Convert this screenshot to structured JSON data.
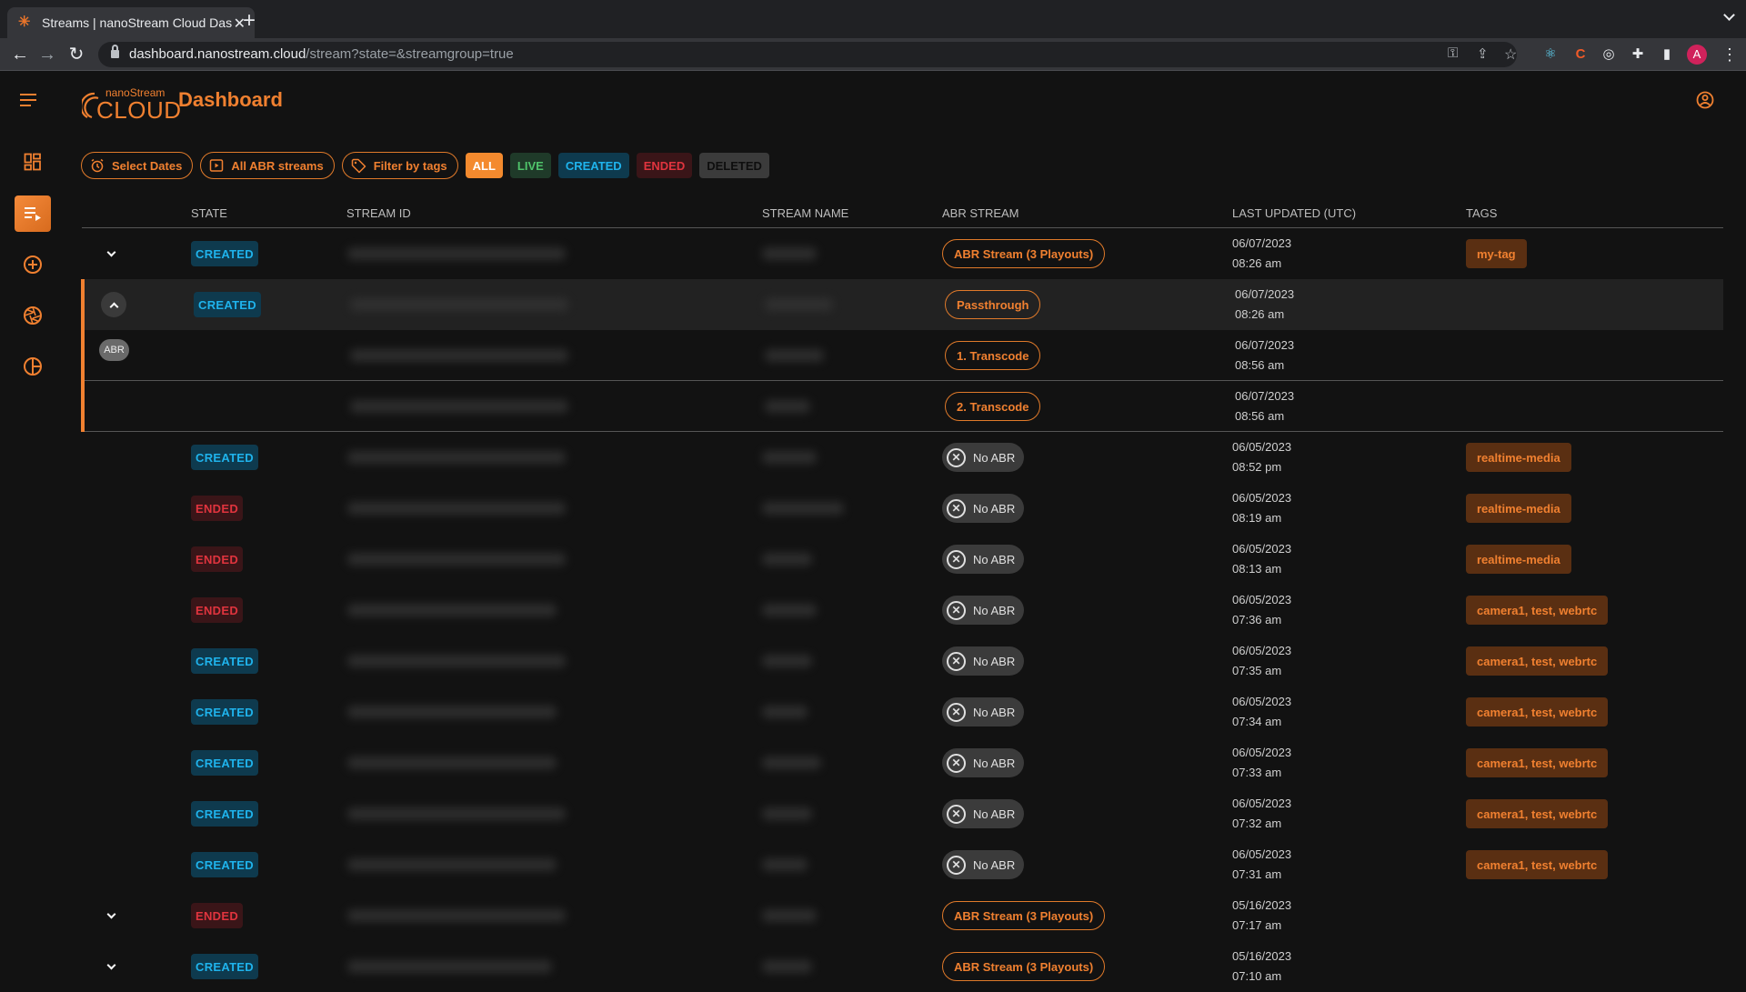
{
  "browser": {
    "tab_title": "Streams | nanoStream Cloud Dashboard",
    "url_host": "dashboard.nanostream.cloud",
    "url_path": "/stream?state=&streamgroup=true",
    "profile_initial": "A"
  },
  "app": {
    "logo_small": "nanoStream",
    "logo_big": "CLOUD",
    "title": "Dashboard"
  },
  "sidebar": {
    "items": [
      {
        "name": "dashboard",
        "icon": "dashboard-icon",
        "active": false
      },
      {
        "name": "streams",
        "icon": "stream-list-icon",
        "active": true
      },
      {
        "name": "create-stream",
        "icon": "add-circle-icon",
        "active": false
      },
      {
        "name": "apertures",
        "icon": "shutter-icon",
        "active": false
      },
      {
        "name": "analytics",
        "icon": "pie-chart-icon",
        "active": false
      }
    ]
  },
  "filters": {
    "select_dates": "Select Dates",
    "abr_streams": "All ABR streams",
    "filter_tags": "Filter by tags",
    "states": [
      {
        "label": "ALL",
        "bg": "#f48a2e",
        "fg": "#ffffff",
        "active": true
      },
      {
        "label": "LIVE",
        "bg": "#1f3a29",
        "fg": "#4fc36a",
        "active": false
      },
      {
        "label": "CREATED",
        "bg": "#0e3a4e",
        "fg": "#1fb3ec",
        "active": false
      },
      {
        "label": "ENDED",
        "bg": "#3a1518",
        "fg": "#e0343e",
        "active": false
      },
      {
        "label": "DELETED",
        "bg": "#3b3b3b",
        "fg": "#0e0e0e",
        "active": false
      }
    ]
  },
  "table": {
    "columns": [
      "STATE",
      "STREAM ID",
      "STREAM NAME",
      "ABR STREAM",
      "LAST UPDATED (UTC)",
      "TAGS"
    ],
    "abr_label": "ABR",
    "rows": [
      {
        "expander": "down",
        "state": "CREATED",
        "abr": "ABR Stream (3 Playouts)",
        "abr_type": "pill",
        "date": "06/07/2023",
        "time": "08:26 am",
        "tag": "my-tag"
      },
      {
        "expander": "up",
        "state": "CREATED",
        "abr": "Passthrough",
        "abr_type": "pill",
        "date": "06/07/2023",
        "time": "08:26 am",
        "tag": "",
        "group": "start"
      },
      {
        "expander": "",
        "state": "",
        "abr": "1. Transcode",
        "abr_type": "pill",
        "date": "06/07/2023",
        "time": "08:56 am",
        "tag": "",
        "group": "mid"
      },
      {
        "expander": "",
        "state": "",
        "abr": "2. Transcode",
        "abr_type": "pill",
        "date": "06/07/2023",
        "time": "08:56 am",
        "tag": "",
        "group": "end"
      },
      {
        "expander": "",
        "state": "CREATED",
        "abr": "No ABR",
        "abr_type": "none",
        "date": "06/05/2023",
        "time": "08:52 pm",
        "tag": "realtime-media"
      },
      {
        "expander": "",
        "state": "ENDED",
        "abr": "No ABR",
        "abr_type": "none",
        "date": "06/05/2023",
        "time": "08:19 am",
        "tag": "realtime-media"
      },
      {
        "expander": "",
        "state": "ENDED",
        "abr": "No ABR",
        "abr_type": "none",
        "date": "06/05/2023",
        "time": "08:13 am",
        "tag": "realtime-media"
      },
      {
        "expander": "",
        "state": "ENDED",
        "abr": "No ABR",
        "abr_type": "none",
        "date": "06/05/2023",
        "time": "07:36 am",
        "tag": "camera1, test, webrtc"
      },
      {
        "expander": "",
        "state": "CREATED",
        "abr": "No ABR",
        "abr_type": "none",
        "date": "06/05/2023",
        "time": "07:35 am",
        "tag": "camera1, test, webrtc"
      },
      {
        "expander": "",
        "state": "CREATED",
        "abr": "No ABR",
        "abr_type": "none",
        "date": "06/05/2023",
        "time": "07:34 am",
        "tag": "camera1, test, webrtc"
      },
      {
        "expander": "",
        "state": "CREATED",
        "abr": "No ABR",
        "abr_type": "none",
        "date": "06/05/2023",
        "time": "07:33 am",
        "tag": "camera1, test, webrtc"
      },
      {
        "expander": "",
        "state": "CREATED",
        "abr": "No ABR",
        "abr_type": "none",
        "date": "06/05/2023",
        "time": "07:32 am",
        "tag": "camera1, test, webrtc"
      },
      {
        "expander": "",
        "state": "CREATED",
        "abr": "No ABR",
        "abr_type": "none",
        "date": "06/05/2023",
        "time": "07:31 am",
        "tag": "camera1, test, webrtc"
      },
      {
        "expander": "down",
        "state": "ENDED",
        "abr": "ABR Stream (3 Playouts)",
        "abr_type": "pill",
        "date": "05/16/2023",
        "time": "07:17 am",
        "tag": ""
      },
      {
        "expander": "down",
        "state": "CREATED",
        "abr": "ABR Stream (3 Playouts)",
        "abr_type": "pill",
        "date": "05/16/2023",
        "time": "07:10 am",
        "tag": ""
      }
    ]
  }
}
